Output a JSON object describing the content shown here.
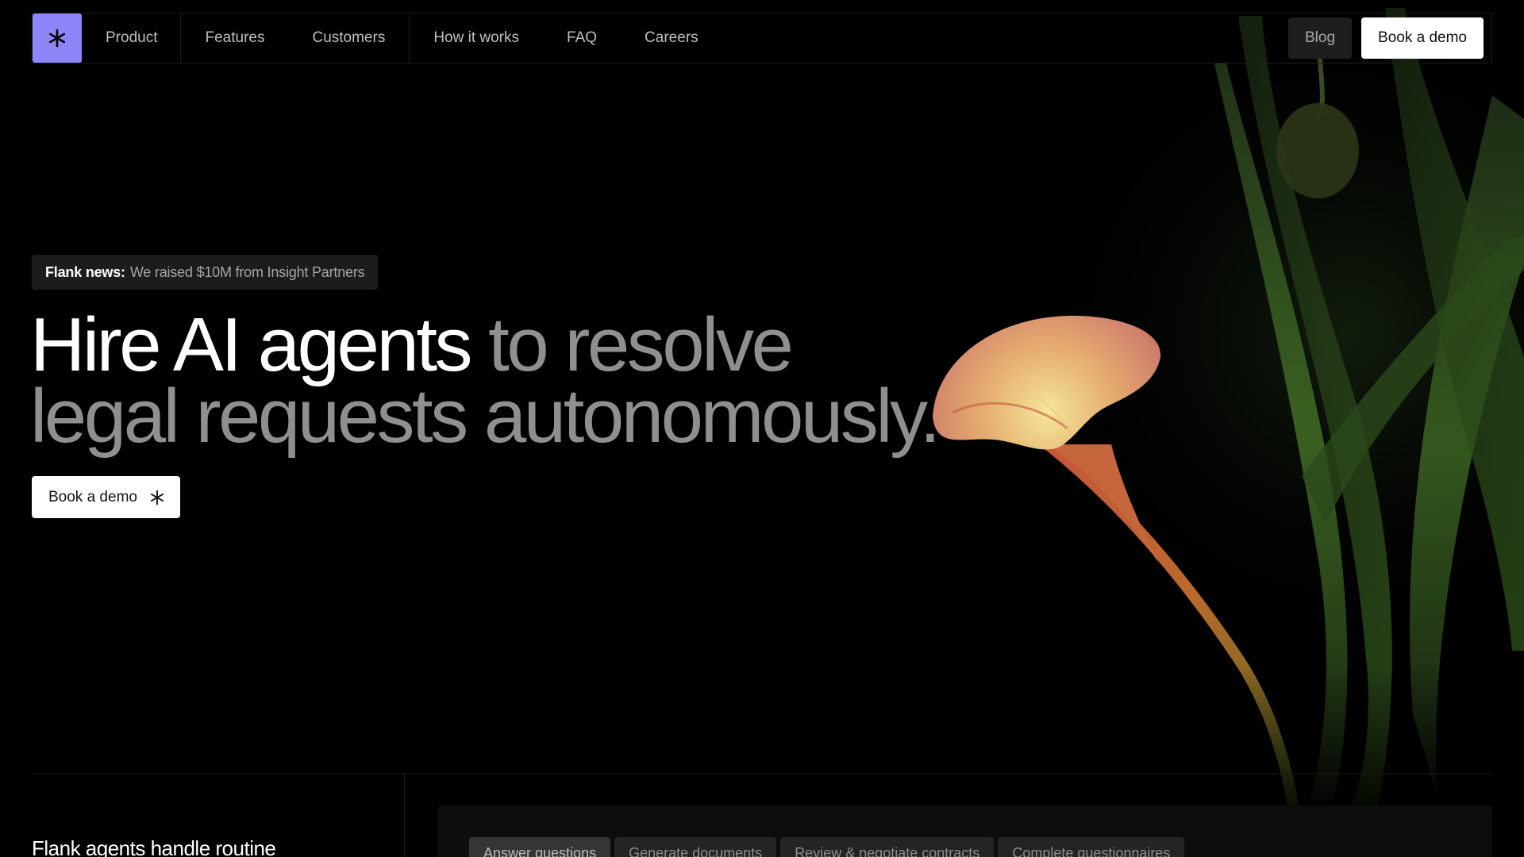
{
  "nav": {
    "items": [
      "Product",
      "Features",
      "Customers",
      "How it works",
      "FAQ",
      "Careers"
    ],
    "blog_label": "Blog",
    "demo_label": "Book a demo"
  },
  "hero": {
    "news_label": "Flank news:",
    "news_text": "We raised $10M from Insight Partners",
    "headline_strong": "Hire AI agents",
    "headline_soft": "to resolve legal requests autonomously.",
    "cta_label": "Book a demo"
  },
  "section": {
    "title": "Flank agents handle routine",
    "tabs": [
      "Answer questions",
      "Generate documents",
      "Review & negotiate contracts",
      "Complete questionnaires"
    ],
    "active_tab": "Answer questions"
  },
  "colors": {
    "background": "#000000",
    "logo_accent": "#8f84f8",
    "headline_soft": "#8f8f8f"
  },
  "icons": {
    "logo": "asterisk-icon",
    "cta": "asterisk-icon"
  }
}
